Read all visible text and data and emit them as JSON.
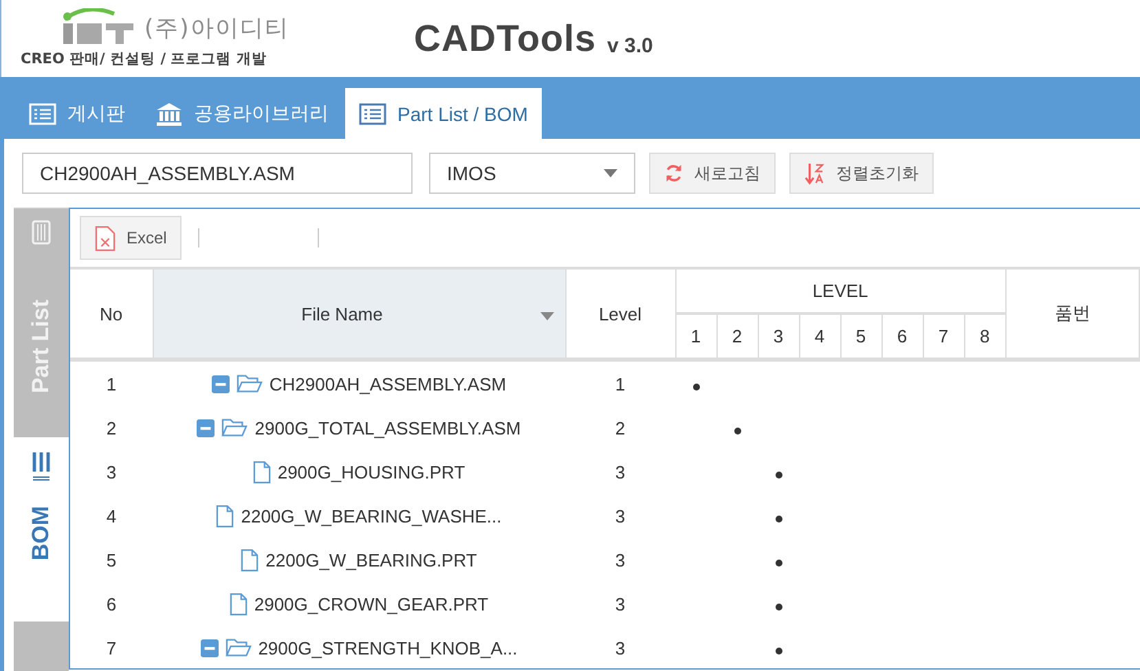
{
  "header": {
    "company": "(주)아이디티",
    "tagline": "CREO 판매/ 컨설팅 / 프로그램 개발",
    "title": "CADTools",
    "version": "v 3.0"
  },
  "tabs": [
    {
      "label": "게시판",
      "kind": "list",
      "selected": false
    },
    {
      "label": "공용라이브러리",
      "kind": "library",
      "selected": false
    },
    {
      "label": "Part List / BOM",
      "kind": "list",
      "selected": true
    }
  ],
  "toolbar": {
    "file_field": "CH2900AH_ASSEMBLY.ASM",
    "source_select": "IMOS",
    "refresh_button": "새로고침",
    "sort_reset_button": "정렬초기화"
  },
  "side_tabs": [
    {
      "label": "Part List",
      "kind": "list",
      "selected": false
    },
    {
      "label": "BOM",
      "kind": "bom",
      "selected": true
    }
  ],
  "grid_toolbar": {
    "excel_button": "Excel"
  },
  "table": {
    "columns": {
      "no": "No",
      "file_name": "File Name",
      "level": "Level",
      "level_group": "LEVEL",
      "level_numbers": [
        "1",
        "2",
        "3",
        "4",
        "5",
        "6",
        "7",
        "8"
      ],
      "part_no": "품번"
    },
    "rows": [
      {
        "no": "1",
        "name": "CH2900AH_ASSEMBLY.ASM",
        "kind": "folder",
        "expanded": true,
        "level": "1",
        "children": [
          {
            "no": "2",
            "name": "2900G_TOTAL_ASSEMBLY.ASM",
            "kind": "folder",
            "expanded": true,
            "level": "2",
            "children": [
              {
                "no": "3",
                "name": "2900G_HOUSING.PRT",
                "kind": "file",
                "level": "3"
              },
              {
                "no": "4",
                "name": "2200G_W_BEARING_WASHE...",
                "kind": "file",
                "level": "3"
              },
              {
                "no": "5",
                "name": "2200G_W_BEARING.PRT",
                "kind": "file",
                "level": "3"
              },
              {
                "no": "6",
                "name": "2900G_CROWN_GEAR.PRT",
                "kind": "file",
                "level": "3"
              },
              {
                "no": "7",
                "name": "2900G_STRENGTH_KNOB_A...",
                "kind": "folder",
                "expanded": true,
                "level": "3"
              }
            ]
          }
        ]
      }
    ]
  }
}
